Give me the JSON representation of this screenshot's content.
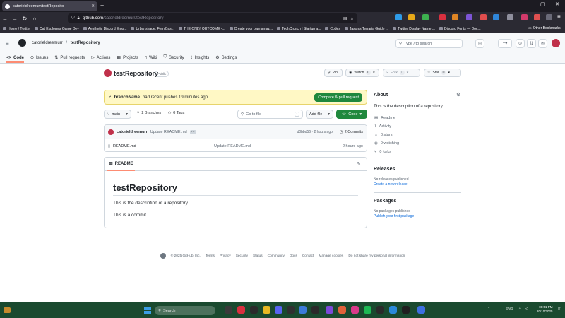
{
  "browser": {
    "tab_title": "catorieldreemurr/testReposito",
    "url_domain": "github.com",
    "url_path": "/catorieldreemurr/testRepository",
    "bookmarks": [
      "Home / Twitter",
      "Cat Explorers Game Dev",
      "Aesthetic Discord Emo...",
      "Urbanshade: Fern Bas...",
      "THE ONLY OUTCOME -...",
      "Create your own amaz...",
      "TechCrunch | Startup a...",
      "Codes",
      "Jason's Terraria Guide ...",
      "Twitter Display Name ...",
      "Discord Fonts — Doc..."
    ],
    "other_bookmarks": "Other Bookmarks"
  },
  "github": {
    "owner": "catorieldreemurr",
    "repo": "testRepository",
    "search_placeholder": "Type / to search",
    "nav": [
      "Code",
      "Issues",
      "Pull requests",
      "Actions",
      "Projects",
      "Wiki",
      "Security",
      "Insights",
      "Settings"
    ],
    "visibility": "Public",
    "pin": "Pin",
    "watch": "Watch",
    "watch_count": "0",
    "fork": "Fork",
    "fork_count": "0",
    "star": "Star",
    "star_count": "0"
  },
  "banner": {
    "branch": "branchName",
    "text": "had recent pushes 19 minutes ago",
    "button": "Compare & pull request"
  },
  "toolbar": {
    "branch": "main",
    "branches": "2 Branches",
    "tags": "0 Tags",
    "goto_placeholder": "Go to file",
    "goto_kbd": "t",
    "add_file": "Add file",
    "code": "Code"
  },
  "latest_commit": {
    "author": "catorieldreemurr",
    "message": "Update README.md",
    "dots": "···",
    "meta": "d0bbd56 · 2 hours ago",
    "commits": "2 Commits"
  },
  "files": [
    {
      "name": "README.md",
      "message": "Update README.md",
      "age": "2 hours ago"
    }
  ],
  "readme": {
    "tab": "README",
    "heading": "testRepository",
    "p1": "This is the description of a repository",
    "p2": "This is a commit"
  },
  "about": {
    "title": "About",
    "description": "This is the description of a repository",
    "items": [
      "Readme",
      "Activity",
      "0 stars",
      "0 watching",
      "0 forks"
    ]
  },
  "releases": {
    "title": "Releases",
    "text": "No releases published",
    "link": "Create a new release"
  },
  "packages": {
    "title": "Packages",
    "text": "No packages published",
    "link": "Publish your first package"
  },
  "footer": {
    "copyright": "© 2025 GitHub, Inc.",
    "links": [
      "Terms",
      "Privacy",
      "Security",
      "Status",
      "Community",
      "Docs",
      "Contact",
      "Manage cookies",
      "Do not share my personal information"
    ]
  },
  "taskbar": {
    "search": "Search",
    "lang": "ENG",
    "time": "08:51 PM",
    "date": "20/10/2025"
  }
}
